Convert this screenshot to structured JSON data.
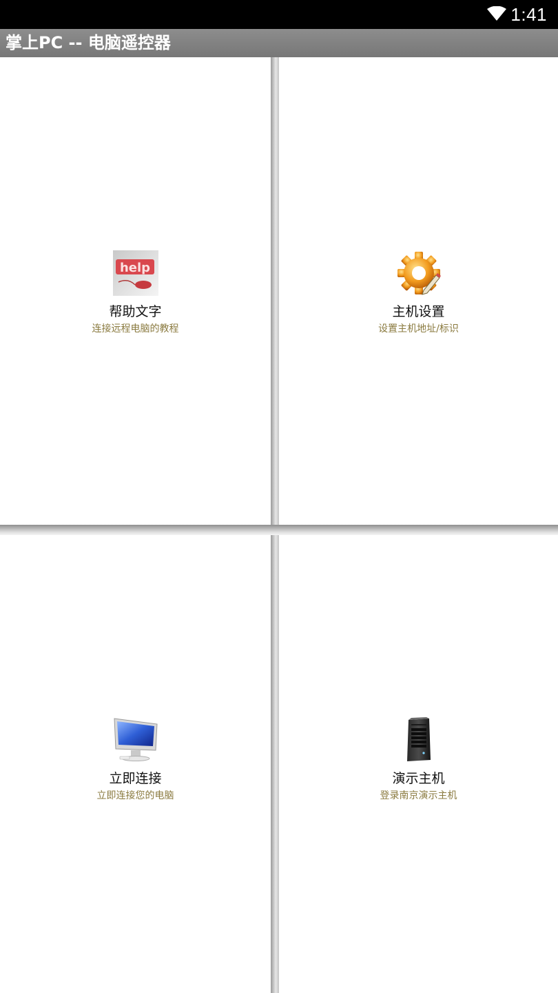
{
  "status_bar": {
    "time": "1:41",
    "wifi_icon": "wifi-icon"
  },
  "app": {
    "title": "掌上PC -- 电脑遥控器"
  },
  "tiles": [
    {
      "id": "help",
      "icon": "help-icon",
      "label": "帮助文字",
      "sub": "连接远程电脑的教程"
    },
    {
      "id": "host",
      "icon": "gear-icon",
      "label": "主机设置",
      "sub": "设置主机地址/标识"
    },
    {
      "id": "connect",
      "icon": "monitor-icon",
      "label": "立即连接",
      "sub": "立即连接您的电脑"
    },
    {
      "id": "demo",
      "icon": "server-icon",
      "label": "演示主机",
      "sub": "登录南京演示主机"
    }
  ],
  "colors": {
    "title_bar": "#808080",
    "subtitle_text": "#8a7a3f",
    "status_bar": "#000000"
  }
}
